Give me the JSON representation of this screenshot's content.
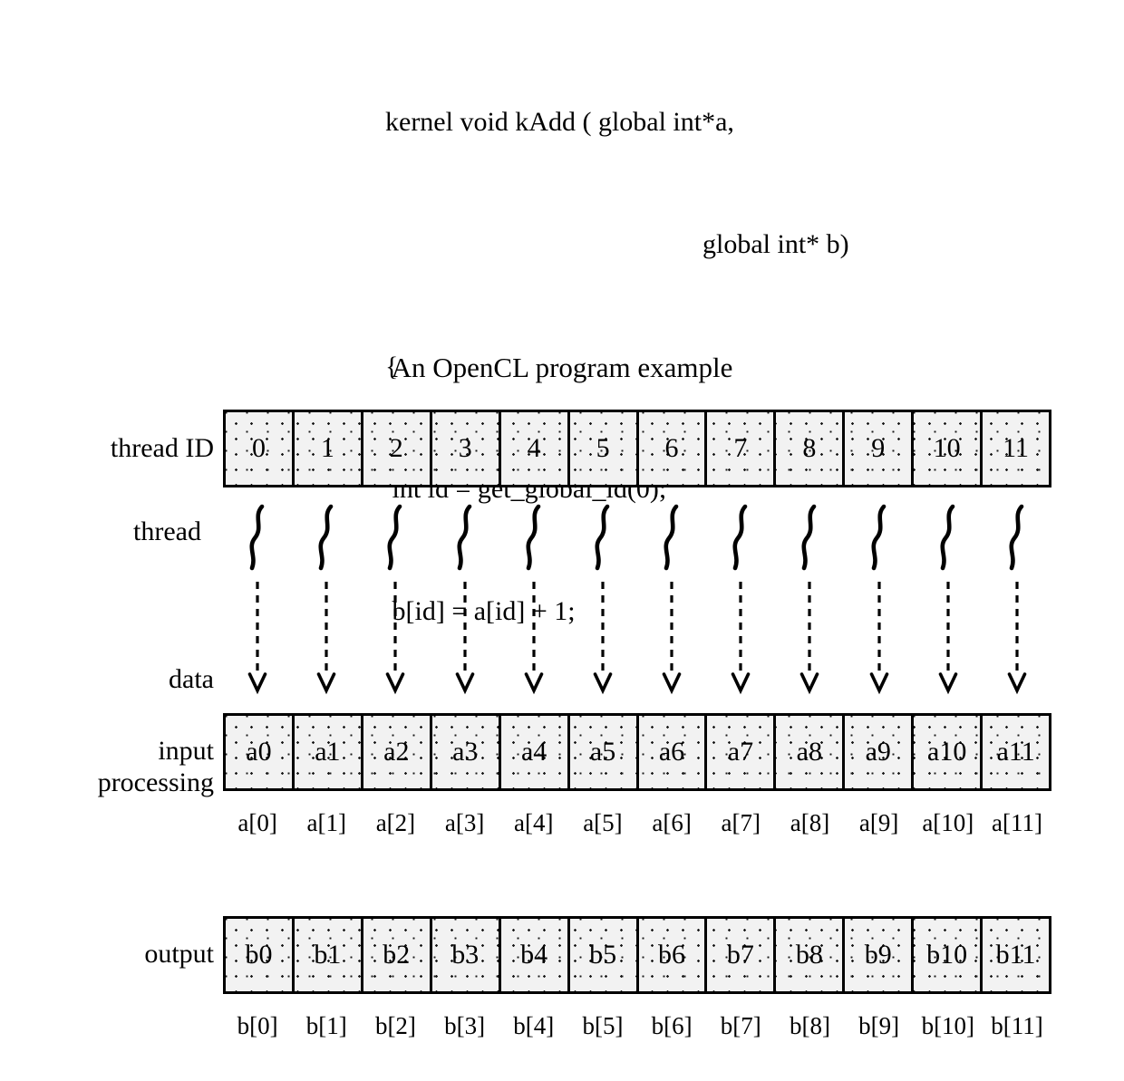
{
  "code": {
    "lines": [
      "kernel void kAdd ( global int*a,",
      "global int* b)",
      "{",
      " int id = get_global_id(0);",
      " b[id] = a[id] + 1;",
      "}"
    ],
    "line1": "kernel void kAdd ( global int*a,",
    "line2": "global int* b)",
    "line3": "{",
    "line4": " int id = get_global_id(0);",
    "line5": " b[id] = a[id] + 1;",
    "line6": "}"
  },
  "caption": "An OpenCL program example",
  "labels": {
    "thread_id": "thread ID",
    "thread": "thread",
    "data_processing_line1": "data",
    "data_processing_line2": "processing",
    "input": "input",
    "output": "output"
  },
  "rows": {
    "thread_ids": [
      "0",
      "1",
      "2",
      "3",
      "4",
      "5",
      "6",
      "7",
      "8",
      "9",
      "10",
      "11"
    ],
    "input_cells": [
      "a0",
      "a1",
      "a2",
      "a3",
      "a4",
      "a5",
      "a6",
      "a7",
      "a8",
      "a9",
      "a10",
      "a11"
    ],
    "input_indices": [
      "a[0]",
      "a[1]",
      "a[2]",
      "a[3]",
      "a[4]",
      "a[5]",
      "a[6]",
      "a[7]",
      "a[8]",
      "a[9]",
      "a[10]",
      "a[11]"
    ],
    "output_cells": [
      "b0",
      "b1",
      "b2",
      "b3",
      "b4",
      "b5",
      "b6",
      "b7",
      "b8",
      "b9",
      "b10",
      "b11"
    ],
    "output_indices": [
      "b[0]",
      "b[1]",
      "b[2]",
      "b[3]",
      "b[4]",
      "b[5]",
      "b[6]",
      "b[7]",
      "b[8]",
      "b[9]",
      "b[10]",
      "b[11]"
    ]
  },
  "glyphs": {
    "thread_symbol": "thread-squiggle-icon",
    "arrow_symbol": "dashed-down-arrow-icon"
  },
  "colors": {
    "ink": "#000000",
    "paper": "#ffffff",
    "cell_fill": "#f2f2f2",
    "stipple": "#1a1a1a"
  }
}
